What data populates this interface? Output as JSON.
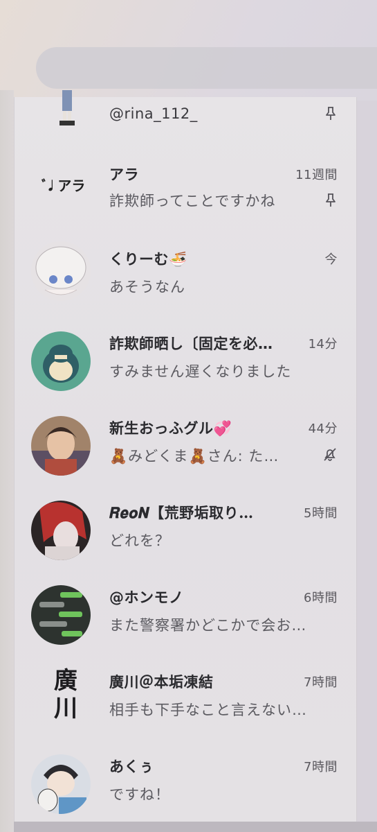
{
  "chats": [
    {
      "name": "@rina_112_",
      "time": "",
      "message": "",
      "pinned": true
    },
    {
      "name": "アラ",
      "time": "11週間",
      "message": "詐欺師ってことですかね",
      "pinned": true
    },
    {
      "name": "くりーむ🍜",
      "time": "今",
      "message": "あそうなん"
    },
    {
      "name": "詐欺師晒し〔固定を必…",
      "time": "14分",
      "message": "すみません遅くなりました"
    },
    {
      "name": "新生おっふグル💞",
      "time": "44分",
      "message": "🧸みどくま🧸さん: た…",
      "muted": true
    },
    {
      "name": "𝑹𝒆𝒐𝑵【荒野垢取り…",
      "time": "5時間",
      "message": "どれを？"
    },
    {
      "name": "@ホンモノ",
      "time": "6時間",
      "message": "また警察署かどこかで会お…"
    },
    {
      "name": "廣川＠本垢凍結",
      "time": "7時間",
      "message": "相手も下手なこと言えない…"
    },
    {
      "name": "あくぅ",
      "time": "7時間",
      "message": "ですね！"
    }
  ],
  "avatars": {
    "ara_logo": "ﾞ𝅘𝅥 アラ",
    "hirokawa_logo": "廣\n川"
  },
  "icons": {
    "pin": "pin-icon",
    "mute": "bell-off-icon"
  }
}
